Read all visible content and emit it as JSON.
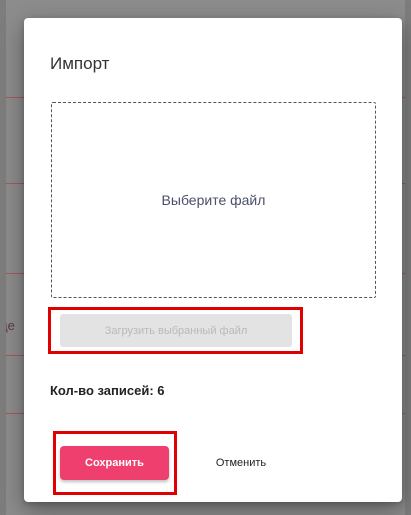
{
  "background": {
    "fragment_text": "де",
    "accent_line_color": "#b04a4a"
  },
  "dialog": {
    "title": "Импорт",
    "dropzone": {
      "label": "Выберите файл"
    },
    "upload_button": {
      "label": "Загрузить выбранный файл",
      "state": "disabled"
    },
    "records_count": "Кол-во записей: 6",
    "actions": {
      "save_label": "Сохранить",
      "cancel_label": "Отменить"
    }
  },
  "colors": {
    "primary": "#ee3f6e",
    "highlight_box": "#e00000",
    "disabled_bg": "#e3e3e3",
    "disabled_text": "#b9b9b9"
  }
}
